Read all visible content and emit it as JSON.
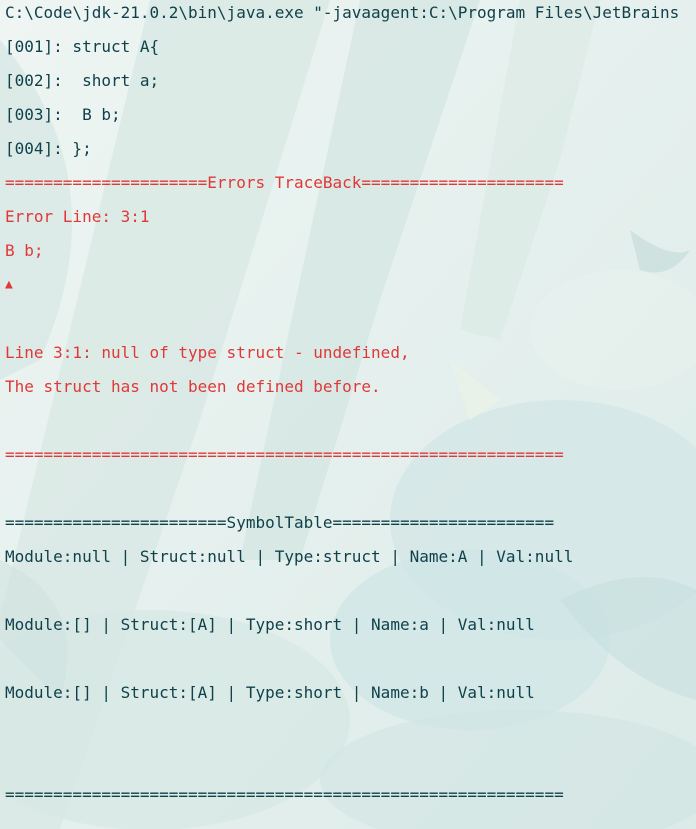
{
  "console": {
    "command": "C:\\Code\\jdk-21.0.2\\bin\\java.exe \"-javaagent:C:\\Program Files\\JetBrains",
    "source_lines": [
      "[001]: struct A{",
      "[002]:  short a;",
      "[003]:  B b;",
      "[004]: };"
    ],
    "error_header": "=====================Errors TraceBack=====================",
    "error_line": "Error Line: 3:1",
    "error_code": "B b;",
    "error_marker": "▲",
    "error_message_1": "Line 3:1: null of type struct - undefined,",
    "error_message_2": "The struct has not been defined before.",
    "error_footer": "==========================================================",
    "symbol_header": "=======================SymbolTable=======================",
    "symbols": [
      "Module:null | Struct:null | Type:struct | Name:A | Val:null",
      "Module:[] | Struct:[A] | Type:short | Name:a | Val:null",
      "Module:[] | Struct:[A] | Type:short | Name:b | Val:null"
    ],
    "symbol_footer": "=========================================================="
  },
  "colors": {
    "output_text": "#10414b",
    "error_text": "#e03838",
    "background": "#e4efec"
  }
}
